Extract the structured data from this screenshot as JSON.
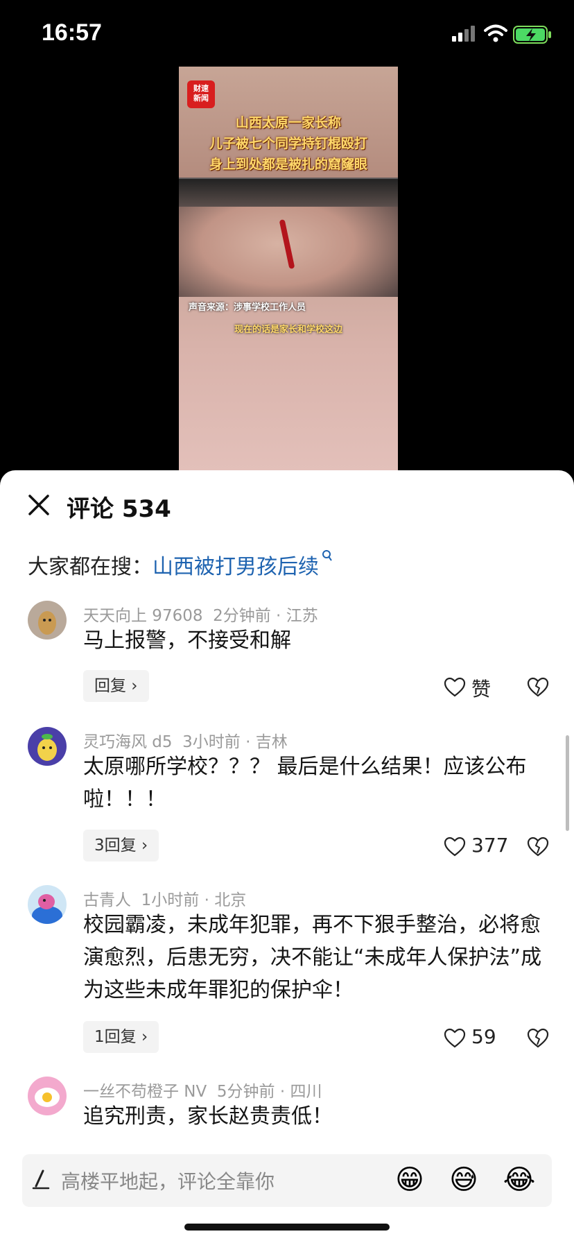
{
  "status_bar": {
    "time": "16:57"
  },
  "video": {
    "badge": "财速\n新闻",
    "caption_lines": [
      "山西太原一家长称",
      "儿子被七个同学持钉棍殴打",
      "身上到处都是被扎的窟窿眼"
    ],
    "subtitle_source": "声音来源：涉事学校工作人员",
    "subtitle_line": "现在的话是家长和学校这边"
  },
  "sheet": {
    "title": "评论 534",
    "search_prefix": "大家都在搜：",
    "search_link": "山西被打男孩后续"
  },
  "comments": [
    {
      "user": "天天向上 97608",
      "time": "2分钟前",
      "location": "江苏",
      "text": "马上报警，不接受和解",
      "reply": "回复 ›",
      "likes": "赞"
    },
    {
      "user": "灵巧海风 d5",
      "time": "3小时前",
      "location": "吉林",
      "text": "太原哪所学校？？？ 最后是什么结果！应该公布啦！！！",
      "reply": "3回复 ›",
      "likes": "377"
    },
    {
      "user": "古青人",
      "time": "1小时前",
      "location": "北京",
      "text": "校园霸凌，未成年犯罪，再不下狠手整治，必将愈演愈烈，后患无穷，决不能让“未成年人保护法”成为这些未成年罪犯的保护伞！",
      "reply": "1回复 ›",
      "likes": "59"
    },
    {
      "user": "一丝不苟橙子 NV",
      "time": "5分钟前",
      "location": "四川",
      "text": "追究刑责，家长赵贵责低！"
    }
  ],
  "input_bar": {
    "placeholder": "高楼平地起，评论全靠你",
    "emojis": [
      "😁",
      "😅",
      "😂"
    ]
  },
  "colors": {
    "link": "#1e63b0",
    "sheet_bg": "#ffffff",
    "meta": "#9a9a9a"
  }
}
